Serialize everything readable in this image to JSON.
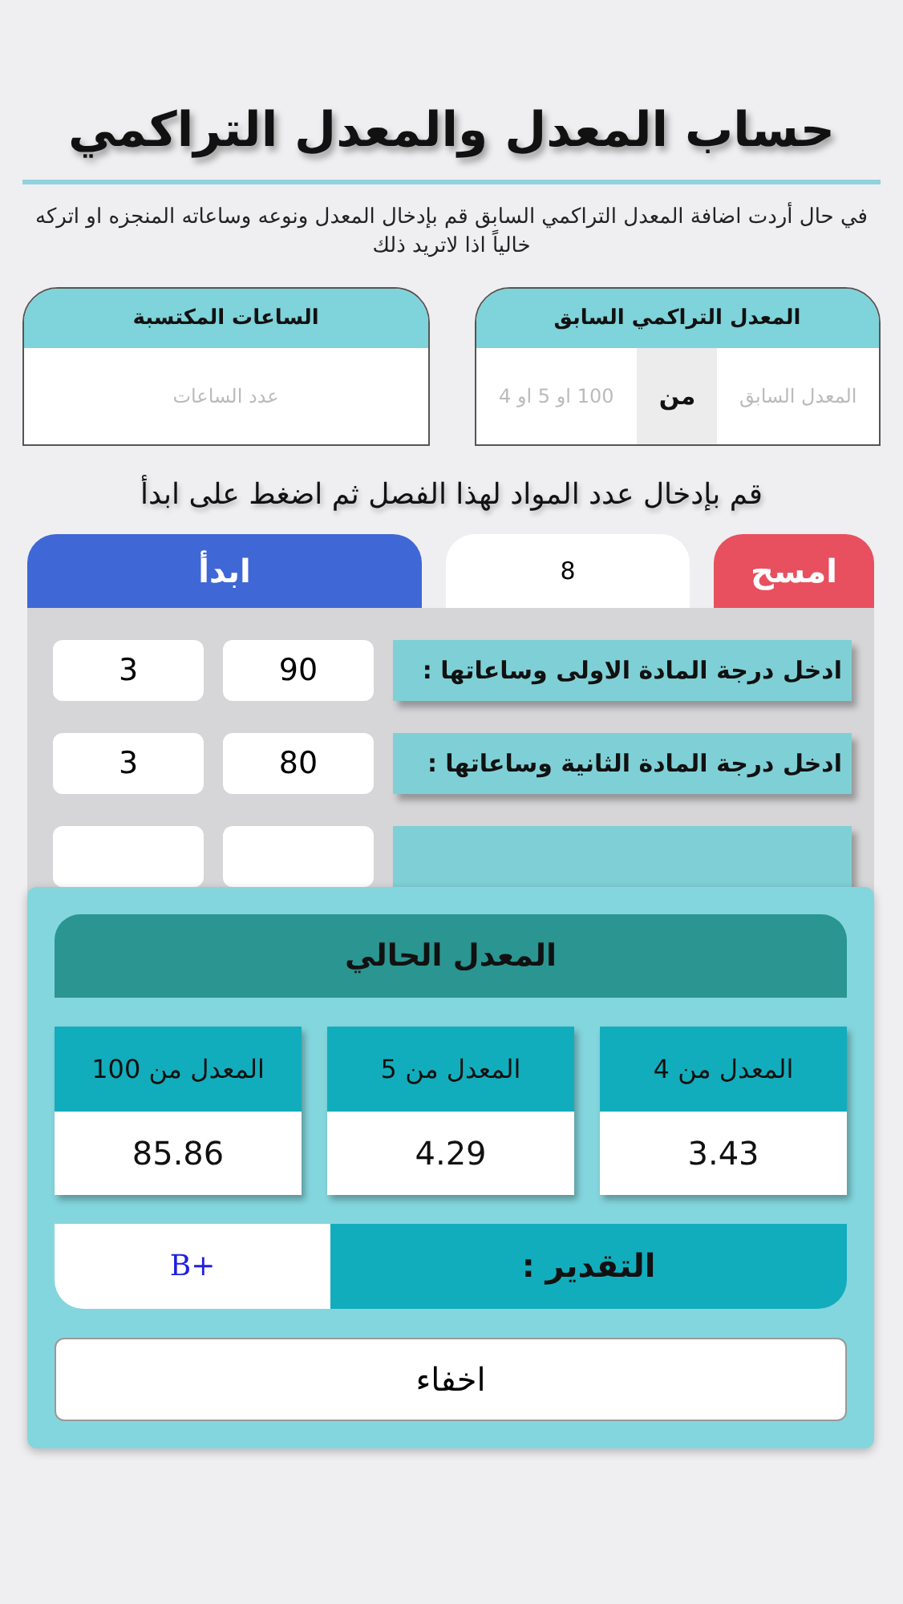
{
  "title": "حساب المعدل والمعدل التراكمي",
  "intro": "في حال أردت اضافة المعدل التراكمي السابق قم بإدخال المعدل ونوعه وساعاته المنجزه او اتركه خالياً اذا لاتريد ذلك",
  "previous_gpa": {
    "title": "المعدل التراكمي السابق",
    "placeholder": "المعدل السابق",
    "separator": "من",
    "scale_placeholder": "100 او 5 او 4"
  },
  "earned_hours": {
    "title": "الساعات المكتسبة",
    "placeholder": "عدد الساعات"
  },
  "instruction": "قم بإدخال عدد المواد لهذا الفصل ثم اضغط على ابدأ",
  "clear_button": "امسح",
  "subject_count": "8",
  "start_button": "ابدأ",
  "subjects": [
    {
      "label": "ادخل درجة المادة الاولى وساعاتها :",
      "grade": "90",
      "hours": "3"
    },
    {
      "label": "ادخل درجة المادة الثانية وساعاتها :",
      "grade": "80",
      "hours": "3"
    }
  ],
  "result": {
    "title": "المعدل الحالي",
    "cards": [
      {
        "label": "المعدل من 4",
        "value": "3.43"
      },
      {
        "label": "المعدل من 5",
        "value": "4.29"
      },
      {
        "label": "المعدل من 100",
        "value": "85.86"
      }
    ],
    "grade_label": "التقدير :",
    "grade": "B+",
    "hide_button": "اخفاء"
  }
}
